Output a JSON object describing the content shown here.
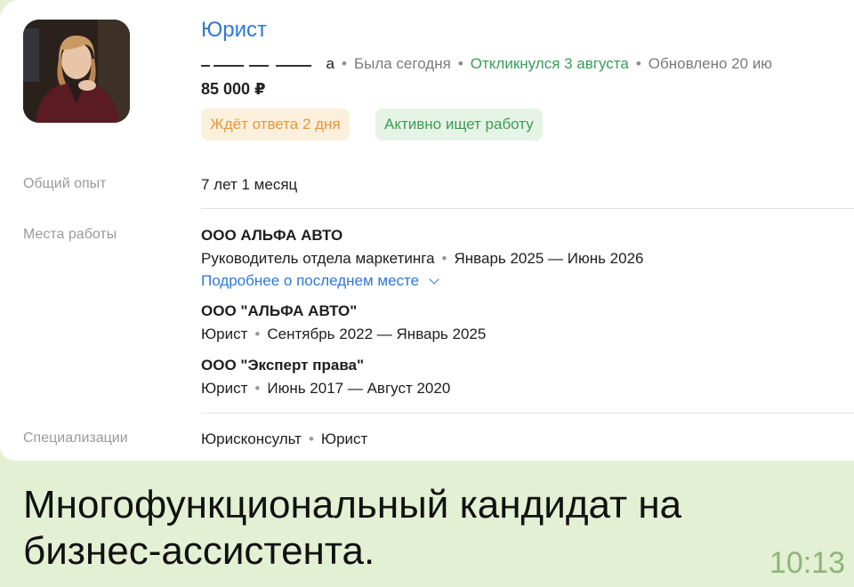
{
  "resume": {
    "title": "Юрист",
    "meta": {
      "name_suffix": "а",
      "last_seen": "Была сегодня",
      "responded": "Откликнулся 3 августа",
      "updated": "Обновлено 20 ию"
    },
    "salary": "85 000 ₽",
    "chips": {
      "waiting": "Ждёт ответа 2 дня",
      "status": "Активно ищет работу"
    },
    "experience": {
      "label": "Общий опыт",
      "value": "7 лет 1 месяц"
    },
    "workplaces": {
      "label": "Места работы",
      "items": [
        {
          "company": "ООО АЛЬФА АВТО",
          "position": "Руководитель отдела маркетинга",
          "period": "Январь 2025 — Июнь 2026",
          "more_link": "Подробнее о последнем месте"
        },
        {
          "company": "ООО \"АЛЬФА АВТО\"",
          "position": "Юрист",
          "period": "Сентябрь 2022 — Январь 2025"
        },
        {
          "company": "ООО \"Эксперт права\"",
          "position": "Юрист",
          "period": "Июнь 2017 — Август 2020"
        }
      ]
    },
    "specializations": {
      "label": "Специализации",
      "items": [
        "Юрисконсульт",
        "Юрист"
      ]
    }
  },
  "message": {
    "text": "Многофункциональный кандидат на бизнес-ассистента.",
    "time": "10:13"
  },
  "colors": {
    "link": "#2f78d8",
    "green_status": "#3a9b5a",
    "wait_chip_text": "#e7973b",
    "chat_background": "#e3f0d3",
    "timestamp": "#8fb47a"
  }
}
